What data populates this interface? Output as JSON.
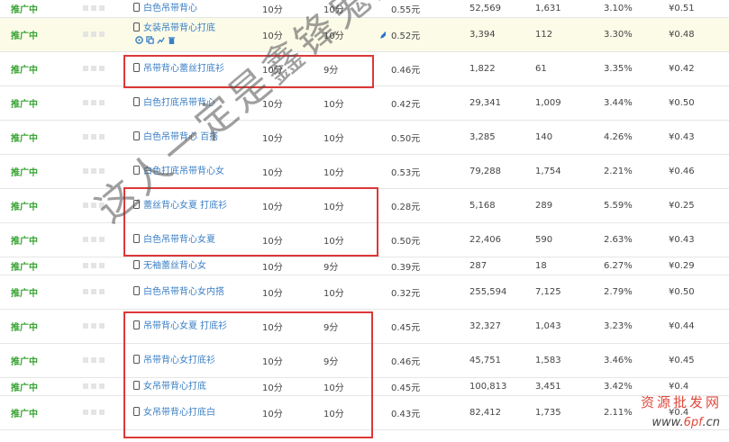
{
  "rows": [
    {
      "status": "推广中",
      "keyword": "白色吊带背心",
      "pc_bid": "10分",
      "mobile_bid": "10分",
      "cpc": "0.55元",
      "impressions": "52,569",
      "clicks": "1,631",
      "ctr": "3.10%",
      "avg": "¥0.51"
    },
    {
      "status": "推广中",
      "keyword": "女装吊带背心打底",
      "pc_bid": "10分",
      "mobile_bid": "10分",
      "cpc": "0.52元",
      "impressions": "3,394",
      "clicks": "112",
      "ctr": "3.30%",
      "avg": "¥0.48",
      "highlight": true
    },
    {
      "status": "推广中",
      "keyword": "吊带背心蕾丝打底衫",
      "pc_bid": "10分",
      "mobile_bid": "9分",
      "cpc": "0.46元",
      "impressions": "1,822",
      "clicks": "61",
      "ctr": "3.35%",
      "avg": "¥0.42"
    },
    {
      "status": "推广中",
      "keyword": "白色打底吊带背心",
      "pc_bid": "10分",
      "mobile_bid": "10分",
      "cpc": "0.42元",
      "impressions": "29,341",
      "clicks": "1,009",
      "ctr": "3.44%",
      "avg": "¥0.50"
    },
    {
      "status": "推广中",
      "keyword": "白色吊带背心 百搭",
      "pc_bid": "10分",
      "mobile_bid": "10分",
      "cpc": "0.50元",
      "impressions": "3,285",
      "clicks": "140",
      "ctr": "4.26%",
      "avg": "¥0.43"
    },
    {
      "status": "推广中",
      "keyword": "白色打底吊带背心女",
      "pc_bid": "10分",
      "mobile_bid": "10分",
      "cpc": "0.53元",
      "impressions": "79,288",
      "clicks": "1,754",
      "ctr": "2.21%",
      "avg": "¥0.46"
    },
    {
      "status": "推广中",
      "keyword": "蕾丝背心女夏 打底衫",
      "pc_bid": "10分",
      "mobile_bid": "10分",
      "cpc": "0.28元",
      "impressions": "5,168",
      "clicks": "289",
      "ctr": "5.59%",
      "avg": "¥0.25"
    },
    {
      "status": "推广中",
      "keyword": "白色吊带背心女夏",
      "pc_bid": "10分",
      "mobile_bid": "10分",
      "cpc": "0.50元",
      "impressions": "22,406",
      "clicks": "590",
      "ctr": "2.63%",
      "avg": "¥0.43"
    },
    {
      "status": "推广中",
      "keyword": "无袖蕾丝背心女",
      "pc_bid": "10分",
      "mobile_bid": "9分",
      "cpc": "0.39元",
      "impressions": "287",
      "clicks": "18",
      "ctr": "6.27%",
      "avg": "¥0.29"
    },
    {
      "status": "推广中",
      "keyword": "白色吊带背心女内搭",
      "pc_bid": "10分",
      "mobile_bid": "10分",
      "cpc": "0.32元",
      "impressions": "255,594",
      "clicks": "7,125",
      "ctr": "2.79%",
      "avg": "¥0.50"
    },
    {
      "status": "推广中",
      "keyword": "吊带背心女夏 打底衫",
      "pc_bid": "10分",
      "mobile_bid": "9分",
      "cpc": "0.45元",
      "impressions": "32,327",
      "clicks": "1,043",
      "ctr": "3.23%",
      "avg": "¥0.44"
    },
    {
      "status": "推广中",
      "keyword": "吊带背心女打底衫",
      "pc_bid": "10分",
      "mobile_bid": "9分",
      "cpc": "0.46元",
      "impressions": "45,751",
      "clicks": "1,583",
      "ctr": "3.46%",
      "avg": "¥0.45"
    },
    {
      "status": "推广中",
      "keyword": "女吊带背心打底",
      "pc_bid": "10分",
      "mobile_bid": "10分",
      "cpc": "0.45元",
      "impressions": "100,813",
      "clicks": "3,451",
      "ctr": "3.42%",
      "avg": "¥0.4"
    },
    {
      "status": "推广中",
      "keyword": "女吊带背心打底白",
      "pc_bid": "10分",
      "mobile_bid": "10分",
      "cpc": "0.43元",
      "impressions": "82,412",
      "clicks": "1,735",
      "ctr": "2.11%",
      "avg": "¥0.4"
    }
  ],
  "watermark": {
    "main": "这人一定是鑫锋鬼剑",
    "site_name": "资源批发网",
    "site_url_prefix": "www.",
    "site_url_highlight": "6pf",
    "site_url_suffix": ".cn"
  },
  "colors": {
    "status": "#3aa335",
    "keyword": "#3b7fc4",
    "highlight_row": "#fbfbe8",
    "annotation_box": "#dd3838"
  },
  "icons": {
    "device": "mobile-phone-icon",
    "edit": "pencil-edit-icon"
  }
}
